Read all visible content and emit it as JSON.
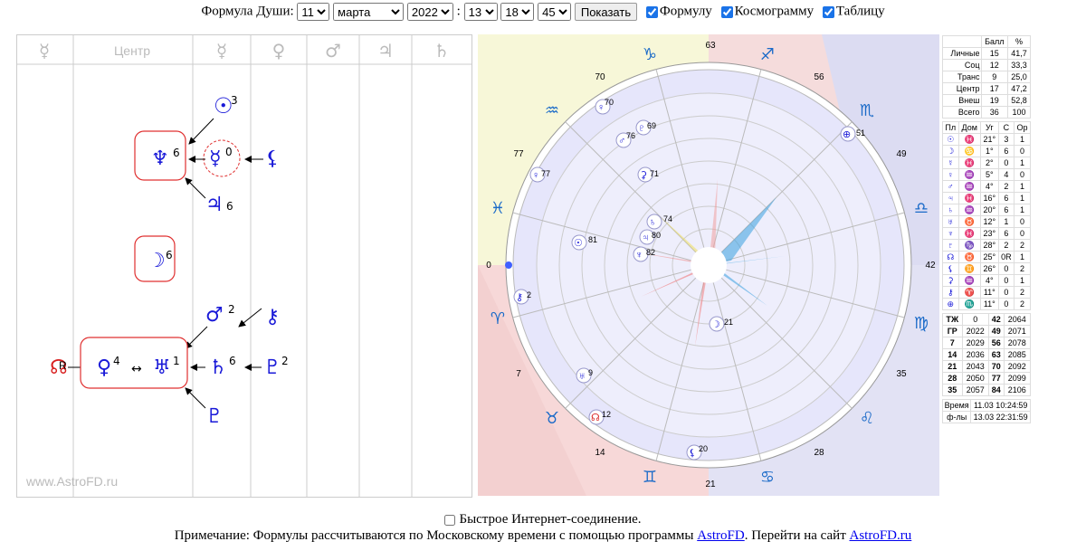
{
  "controls": {
    "label": "Формула Души:",
    "day": "11",
    "month": "марта",
    "year": "2022",
    "hour": "13",
    "minute": "18",
    "second": "45",
    "sep": ":",
    "show_button": "Показать",
    "cb_formula": "Формулу",
    "cb_cosmogram": "Космограмму",
    "cb_table": "Таблицу"
  },
  "formula_panel": {
    "header_center": "Центр",
    "watermark": "www.AstroFD.ru",
    "nodes": {
      "sun_num": "3",
      "neptune_num": "6",
      "mercury_num": "0",
      "jupiter_num": "6",
      "moon_num": "6",
      "mars_num": "2",
      "venus_num": "4",
      "uranus_num": "1",
      "saturn_num": "6",
      "pluto_num": "2",
      "node_r": "R"
    }
  },
  "cosmogram": {
    "degree_labels": [
      "63",
      "56",
      "49",
      "42",
      "35",
      "28",
      "21",
      "14",
      "7",
      "0",
      "77",
      "70"
    ],
    "planet_labels": [
      "70",
      "69",
      "76",
      "71",
      "77",
      "74",
      "80",
      "81",
      "82",
      "51",
      "2",
      "21",
      "9",
      "12",
      "20"
    ]
  },
  "table_scores": {
    "header": [
      "",
      "Балл",
      "%"
    ],
    "rows": [
      [
        "Личные",
        "15",
        "41,7"
      ],
      [
        "Соц",
        "12",
        "33,3"
      ],
      [
        "Транс",
        "9",
        "25,0"
      ],
      [
        "Центр",
        "17",
        "47,2"
      ],
      [
        "Внеш",
        "19",
        "52,8"
      ],
      [
        "Всего",
        "36",
        "100"
      ]
    ]
  },
  "table_planets": {
    "header": [
      "Пл",
      "Дом",
      "Уг",
      "С",
      "Ор"
    ],
    "rows": [
      [
        "☉",
        "♓",
        "21°",
        "3",
        "1"
      ],
      [
        "☽",
        "♋",
        "1°",
        "6",
        "0"
      ],
      [
        "☿",
        "♓",
        "2°",
        "0",
        "1"
      ],
      [
        "♀",
        "♒",
        "5°",
        "4",
        "0"
      ],
      [
        "♂",
        "♒",
        "4°",
        "2",
        "1"
      ],
      [
        "♃",
        "♓",
        "16°",
        "6",
        "1"
      ],
      [
        "♄",
        "♒",
        "20°",
        "6",
        "1"
      ],
      [
        "♅",
        "♉",
        "12°",
        "1",
        "0"
      ],
      [
        "♆",
        "♓",
        "23°",
        "6",
        "0"
      ],
      [
        "♇",
        "♑",
        "28°",
        "2",
        "2"
      ],
      [
        "☊",
        "♉",
        "25°",
        "0R",
        "1"
      ],
      [
        "⚸",
        "♊",
        "26°",
        "0",
        "2"
      ],
      [
        "⚳",
        "♒",
        "4°",
        "0",
        "1"
      ],
      [
        "⚷",
        "♈",
        "11°",
        "0",
        "2"
      ],
      [
        "⊕",
        "♏",
        "11°",
        "0",
        "2"
      ]
    ]
  },
  "table_years": {
    "header": [
      "ТЖ",
      "0",
      "42",
      "2064"
    ],
    "rows": [
      [
        "ГР",
        "2022",
        "49",
        "2071"
      ],
      [
        "7",
        "2029",
        "56",
        "2078"
      ],
      [
        "14",
        "2036",
        "63",
        "2085"
      ],
      [
        "21",
        "2043",
        "70",
        "2092"
      ],
      [
        "28",
        "2050",
        "77",
        "2099"
      ],
      [
        "35",
        "2057",
        "84",
        "2106"
      ]
    ]
  },
  "table_time": {
    "rows": [
      [
        "Время",
        "11.03 10:24:59"
      ],
      [
        "ф-лы",
        "13.03 22:31:59"
      ]
    ]
  },
  "footer": {
    "fast_label": "Быстрое Интернет-соединение.",
    "note_pre": "Примечание: Формулы рассчитываются по Московскому времени с помощью программы ",
    "link1": "AstroFD",
    "note_mid": ". Перейти на сайт ",
    "link2": "AstroFD.ru"
  }
}
